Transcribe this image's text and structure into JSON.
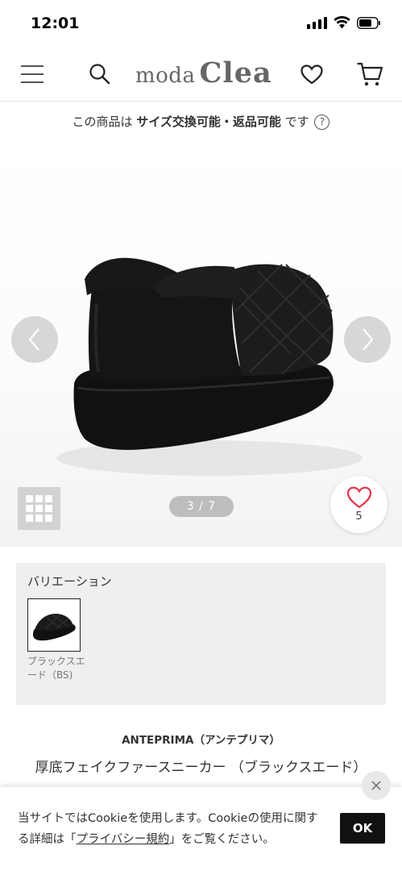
{
  "status_bar": {
    "time": "12:01",
    "battery_icon": "battery-icon",
    "wifi_icon": "wifi-icon",
    "signal_icon": "signal-icon"
  },
  "header": {
    "logo_part1": "moda",
    "logo_part2": "Clea",
    "menu_icon": "hamburger-menu-icon",
    "search_icon": "search-icon",
    "favorite_icon": "heart-icon",
    "cart_icon": "cart-icon"
  },
  "notice": {
    "prefix": "この商品は",
    "highlight": "サイズ交換可能・返品可能",
    "suffix": "です",
    "help_icon": "question-circle-icon",
    "help_glyph": "?"
  },
  "gallery": {
    "counter": "3 / 7",
    "favorite_count": "5",
    "prev_icon": "chevron-left-icon",
    "next_icon": "chevron-right-icon",
    "grid_icon": "grid-view-icon"
  },
  "variation": {
    "title": "バリエーション",
    "items": [
      {
        "label": "ブラックスエード（BS)"
      }
    ]
  },
  "product": {
    "brand": "ANTEPRIMA（アンテプリマ）",
    "title": "厚底フェイクファースニーカー （ブラックスエード）"
  },
  "cookie": {
    "text_before": "当サイトではCookieを使用します。Cookieの使用に関する詳細は「",
    "link": "プライバシー規約",
    "text_after": "」をご覧ください。",
    "ok_label": "OK",
    "close_icon": "close-icon"
  },
  "colors": {
    "accent_heart": "#e8364f",
    "ok_button": "#111111",
    "arrow_bg": "#d6d6d6"
  }
}
